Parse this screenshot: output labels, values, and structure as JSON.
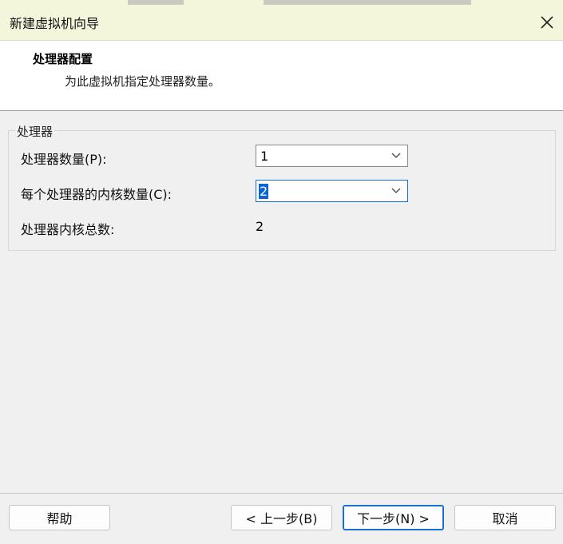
{
  "window": {
    "title": "新建虚拟机向导"
  },
  "header": {
    "title": "处理器配置",
    "subtitle": "为此虚拟机指定处理器数量。"
  },
  "processor_group": {
    "legend": "处理器",
    "processor_count_label": "处理器数量(P):",
    "processor_count_value": "1",
    "cores_per_processor_label": "每个处理器的内核数量(C):",
    "cores_per_processor_value": "2",
    "total_cores_label": "处理器内核总数:",
    "total_cores_value": "2"
  },
  "buttons": {
    "help": "帮助",
    "back": "< 上一步(B)",
    "next": "下一步(N) >",
    "cancel": "取消"
  },
  "icons": {
    "close": "close-icon",
    "dropdown": "chevron-down-icon"
  },
  "colors": {
    "titlebar_bg": "#f4f6dc",
    "focus_border": "#1a6fd0",
    "selection_bg": "#0a64d8"
  }
}
